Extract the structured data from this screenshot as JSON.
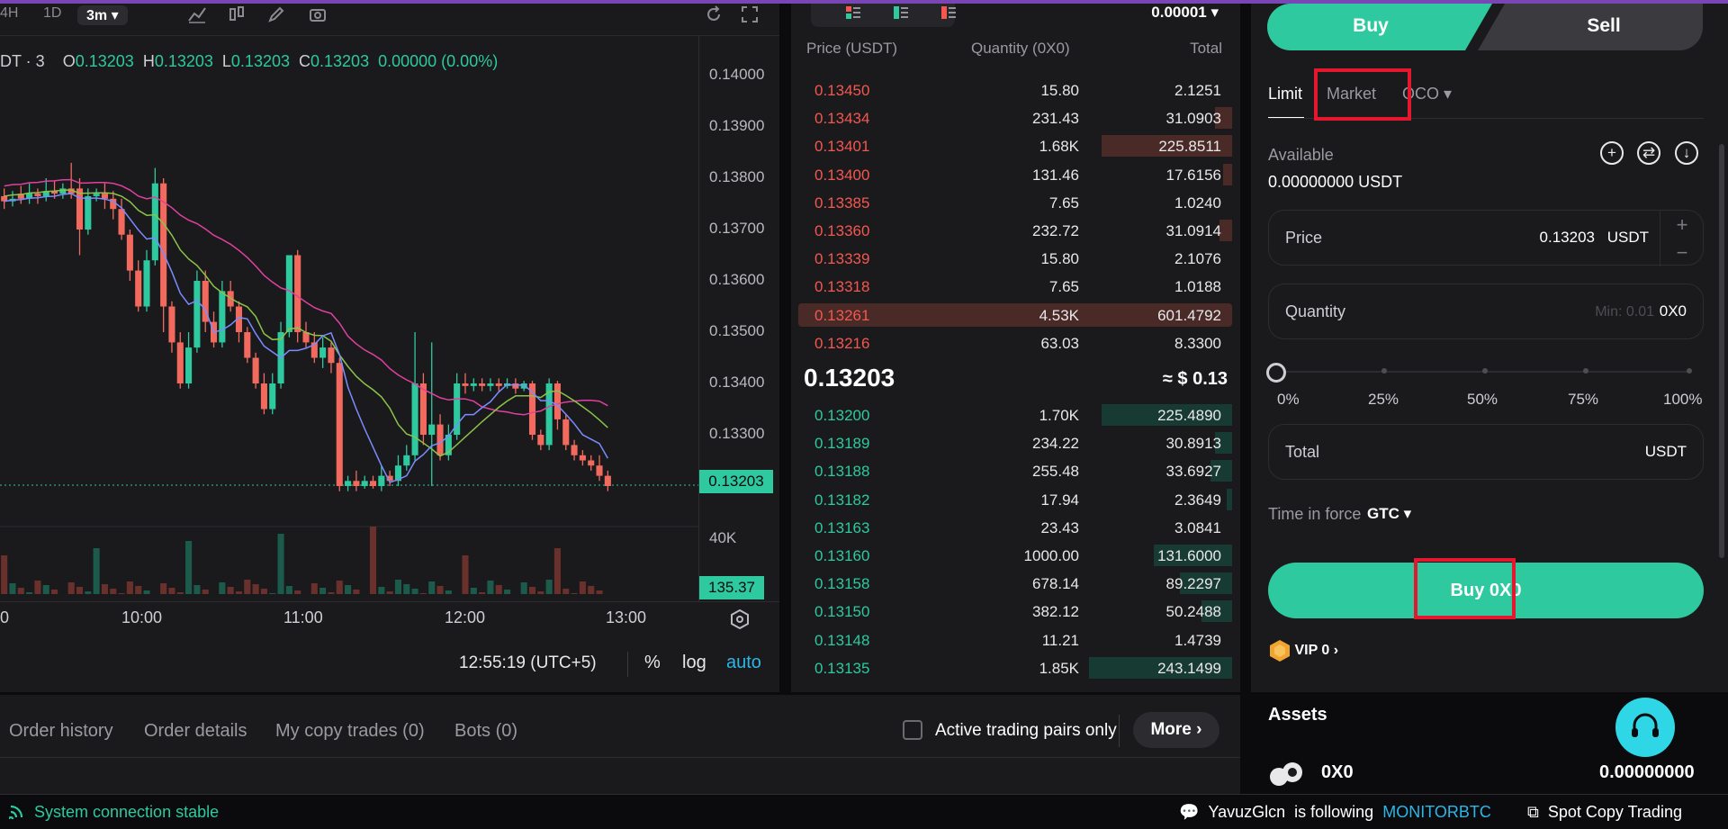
{
  "chart": {
    "toolbar": {
      "tf_4h": "4H",
      "tf_1d": "1D",
      "tf_active": "3m"
    },
    "pair_partial": "DT · 3",
    "ohlc": {
      "o_lab": "O",
      "o": "0.13203",
      "h_lab": "H",
      "h": "0.13203",
      "l_lab": "L",
      "l": "0.13203",
      "c_lab": "C",
      "c": "0.13203",
      "chg": "0.00000 (0.00%)"
    },
    "price_axis": [
      "0.14000",
      "0.13900",
      "0.13800",
      "0.13700",
      "0.13600",
      "0.13500",
      "0.13400",
      "0.13300"
    ],
    "current_price": "0.13203",
    "volume_axis": "40K",
    "volume_tag": "135.37",
    "time_axis": [
      "10:00",
      "11:00",
      "12:00",
      "13:00"
    ],
    "clock": "12:55:19 (UTC+5)",
    "opt_percent": "%",
    "opt_log": "log",
    "opt_auto": "auto",
    "colors": {
      "up": "#2ec99e",
      "down": "#f26a5e"
    }
  },
  "orderbook": {
    "precision": "0.00001",
    "headers": {
      "price": "Price (USDT)",
      "qty": "Quantity (0X0)",
      "total": "Total"
    },
    "asks": [
      {
        "p": "0.13450",
        "q": "15.80",
        "t": "2.1251",
        "d": 0.0
      },
      {
        "p": "0.13434",
        "q": "231.43",
        "t": "31.0903",
        "d": 0.04
      },
      {
        "p": "0.13401",
        "q": "1.68K",
        "t": "225.8511",
        "d": 0.3
      },
      {
        "p": "0.13400",
        "q": "131.46",
        "t": "17.6156",
        "d": 0.02
      },
      {
        "p": "0.13385",
        "q": "7.65",
        "t": "1.0240",
        "d": 0.0
      },
      {
        "p": "0.13360",
        "q": "232.72",
        "t": "31.0914",
        "d": 0.03
      },
      {
        "p": "0.13339",
        "q": "15.80",
        "t": "2.1076",
        "d": 0.0
      },
      {
        "p": "0.13318",
        "q": "7.65",
        "t": "1.0188",
        "d": 0.0
      },
      {
        "p": "0.13261",
        "q": "4.53K",
        "t": "601.4792",
        "d": 1.0
      },
      {
        "p": "0.13216",
        "q": "63.03",
        "t": "8.3300",
        "d": 0.0
      }
    ],
    "mid_price": "0.13203",
    "mid_usd": "≈ $ 0.13",
    "bids": [
      {
        "p": "0.13200",
        "q": "1.70K",
        "t": "225.4890",
        "d": 0.3
      },
      {
        "p": "0.13189",
        "q": "234.22",
        "t": "30.8913",
        "d": 0.04
      },
      {
        "p": "0.13188",
        "q": "255.48",
        "t": "33.6927",
        "d": 0.05
      },
      {
        "p": "0.13182",
        "q": "17.94",
        "t": "2.3649",
        "d": 0.01
      },
      {
        "p": "0.13163",
        "q": "23.43",
        "t": "3.0841",
        "d": 0.0
      },
      {
        "p": "0.13160",
        "q": "1000.00",
        "t": "131.6000",
        "d": 0.18
      },
      {
        "p": "0.13158",
        "q": "678.14",
        "t": "89.2297",
        "d": 0.12
      },
      {
        "p": "0.13150",
        "q": "382.12",
        "t": "50.2488",
        "d": 0.07
      },
      {
        "p": "0.13148",
        "q": "11.21",
        "t": "1.4739",
        "d": 0.0
      },
      {
        "p": "0.13135",
        "q": "1.85K",
        "t": "243.1499",
        "d": 0.33
      }
    ]
  },
  "trade": {
    "buy_tab": "Buy",
    "sell_tab": "Sell",
    "order_types": {
      "limit": "Limit",
      "market": "Market",
      "oco": "OCO"
    },
    "available_label": "Available",
    "available_value": "0.00000000 USDT",
    "price_field": {
      "label": "Price",
      "value": "0.13203",
      "unit": "USDT"
    },
    "qty_field": {
      "label": "Quantity",
      "placeholder": "Min: 0.01",
      "unit": "0X0"
    },
    "slider": {
      "value_percent": 0,
      "labels": [
        "0%",
        "25%",
        "50%",
        "75%",
        "100%"
      ]
    },
    "total_field": {
      "label": "Total",
      "unit": "USDT"
    },
    "tif_label": "Time in force",
    "tif_value": "GTC",
    "buy_button": "Buy 0X0",
    "vip": "VIP 0",
    "assets_title": "Assets",
    "asset": {
      "coin": "0X0",
      "balance": "0.00000000"
    }
  },
  "orders": {
    "tabs": [
      "Order history",
      "Order details",
      "My copy trades (0)",
      "Bots (0)"
    ],
    "active_pairs_label": "Active trading pairs only",
    "more": "More"
  },
  "status": {
    "connection": "System connection stable",
    "follower": "YavuzGlcn",
    "follow_text": "is following",
    "followed": "MONITORBTC",
    "spot_copy": "Spot Copy Trading"
  }
}
